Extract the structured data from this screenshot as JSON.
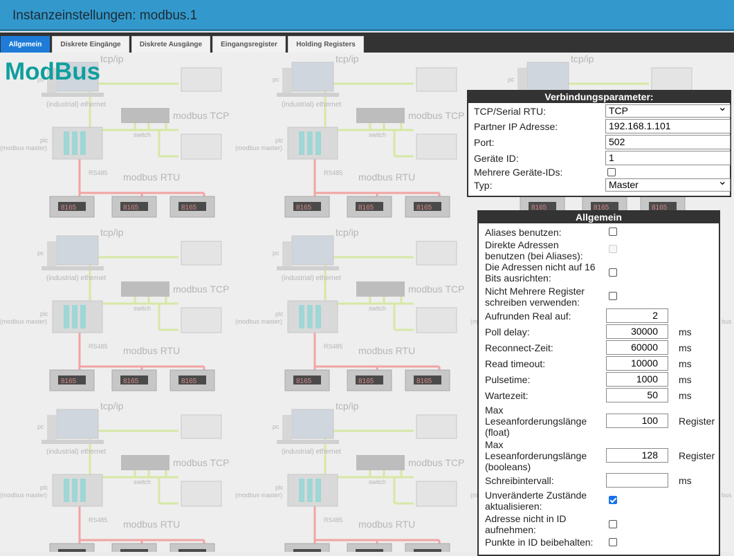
{
  "window": {
    "title": "Instanzeinstellungen: modbus.1"
  },
  "tabs": [
    {
      "label": "Allgemein",
      "active": true
    },
    {
      "label": "Diskrete Eingänge",
      "active": false
    },
    {
      "label": "Diskrete Ausgänge",
      "active": false
    },
    {
      "label": "Eingangsregister",
      "active": false
    },
    {
      "label": "Holding Registers",
      "active": false
    }
  ],
  "brand": {
    "text": "ModBus",
    "color": "#109e9e"
  },
  "diagram": {
    "tcpip": "tcp/ip",
    "pc": "pc",
    "ethernet": "(industrial) ethernet",
    "switch": "switch",
    "modbus_tcp": "modbus TCP",
    "plc": "plc",
    "modbus_master": "(modbus master)",
    "rs485": "RS485",
    "modbus_rtu": "modbus RTU",
    "display_value": "8165",
    "edge_fragment": "bus"
  },
  "connection": {
    "title": "Verbindungsparameter:",
    "mode_label": "TCP/Serial RTU:",
    "mode_value": "TCP",
    "ip_label": "Partner IP Adresse:",
    "ip_value": "192.168.1.101",
    "port_label": "Port:",
    "port_value": "502",
    "device_id_label": "Geräte ID:",
    "device_id_value": "1",
    "multi_ids_label": "Mehrere Geräte-IDs:",
    "multi_ids_checked": false,
    "type_label": "Typ:",
    "type_value": "Master"
  },
  "general": {
    "title": "Allgemein",
    "use_aliases_label": "Aliases benutzen:",
    "direct_addresses_label": "Direkte Adressen benutzen (bei Aliases):",
    "no_align_label": "Die Adressen nicht auf 16 Bits ausrichten:",
    "no_multi_write_label": "Nicht Mehrere Register schreiben verwenden:",
    "round_real_label": "Aufrunden Real auf:",
    "round_real_value": "2",
    "poll_delay_label": "Poll delay:",
    "poll_delay_value": "30000",
    "reconnect_label": "Reconnect-Zeit:",
    "reconnect_value": "60000",
    "read_timeout_label": "Read timeout:",
    "read_timeout_value": "10000",
    "pulsetime_label": "Pulsetime:",
    "pulsetime_value": "1000",
    "wait_label": "Wartezeit:",
    "wait_value": "50",
    "max_read_float_label": "Max Leseanforderungslänge (float)",
    "max_read_float_value": "100",
    "max_read_bool_label": "Max Leseanforderungslänge (booleans)",
    "max_read_bool_value": "128",
    "write_interval_label": "Schreibintervall:",
    "write_interval_value": "",
    "update_unchanged_label": "Unveränderte Zustände aktualisieren:",
    "addr_not_in_id_label": "Adresse nicht in ID aufnehmen:",
    "keep_points_label": "Punkte in ID beibehalten:",
    "unit_ms": "ms",
    "unit_register": "Register"
  }
}
